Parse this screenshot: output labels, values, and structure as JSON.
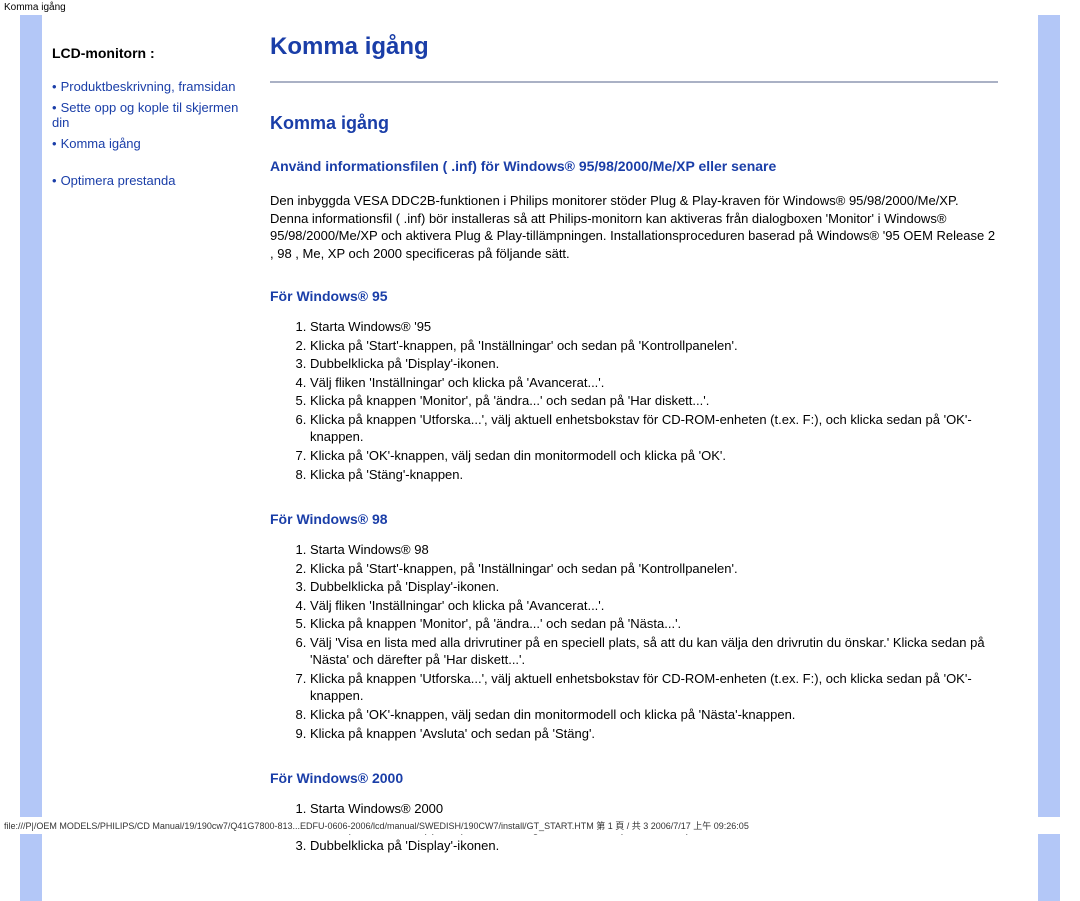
{
  "headerText": "Komma igång",
  "sidebar": {
    "heading": "LCD-monitorn :",
    "items": [
      {
        "label": "Produktbeskrivning, framsidan"
      },
      {
        "label": "Sette opp og kople til skjermen din"
      },
      {
        "label": "Komma igång"
      },
      {
        "label": "Optimera prestanda",
        "spacerBefore": true
      }
    ]
  },
  "main": {
    "h1": "Komma igång",
    "h2": "Komma igång",
    "subhead": "Använd informationsfilen ( .inf) för Windows® 95/98/2000/Me/XP eller senare",
    "paragraph": "Den inbyggda VESA DDC2B-funktionen i Philips monitorer stöder Plug & Play-kraven för Windows® 95/98/2000/Me/XP. Denna informationsfil ( .inf) bör installeras så att Philips-monitorn kan aktiveras från dialogboxen 'Monitor' i Windows® 95/98/2000/Me/XP och aktivera Plug & Play-tillämpningen. Installationsproceduren baserad på Windows® '95 OEM Release 2 , 98 , Me, XP och 2000 specificeras på följande sätt.",
    "sections": [
      {
        "label": "För Windows® 95",
        "steps": [
          "Starta Windows® '95",
          "Klicka på 'Start'-knappen, på 'Inställningar' och sedan på 'Kontrollpanelen'.",
          "Dubbelklicka på 'Display'-ikonen.",
          "Välj fliken 'Inställningar' och klicka på 'Avancerat...'.",
          "Klicka på knappen 'Monitor', på 'ändra...' och sedan på 'Har diskett...'.",
          "Klicka på knappen 'Utforska...', välj aktuell enhetsbokstav för CD-ROM-enheten (t.ex. F:), och klicka sedan på 'OK'-knappen.",
          "Klicka på 'OK'-knappen, välj sedan din monitormodell och klicka på 'OK'.",
          "Klicka på 'Stäng'-knappen."
        ]
      },
      {
        "label": "För Windows® 98",
        "steps": [
          "Starta Windows® 98",
          "Klicka på 'Start'-knappen, på 'Inställningar' och sedan på 'Kontrollpanelen'.",
          "Dubbelklicka på 'Display'-ikonen.",
          "Välj fliken 'Inställningar' och klicka på 'Avancerat...'.",
          "Klicka på knappen 'Monitor', på 'ändra...' och sedan på 'Nästa...'.",
          "Välj 'Visa en lista med alla drivrutiner på en speciell plats, så att du kan välja den drivrutin du önskar.' Klicka sedan på 'Nästa' och därefter på 'Har diskett...'.",
          "Klicka på knappen 'Utforska...', välj aktuell enhetsbokstav för CD-ROM-enheten (t.ex. F:), och klicka sedan på 'OK'-knappen.",
          "Klicka på 'OK'-knappen, välj sedan din monitormodell och klicka på 'Nästa'-knappen.",
          "Klicka på knappen 'Avsluta' och sedan på 'Stäng'."
        ]
      },
      {
        "label": "För Windows® 2000",
        "steps": [
          "Starta Windows® 2000",
          "Klicka på 'Start'-knappen, på 'Inställningar' och sedan på 'Kontrollpanelen'.",
          "Dubbelklicka på 'Display'-ikonen."
        ]
      }
    ]
  },
  "footerPath": "file:///P|/OEM MODELS/PHILIPS/CD Manual/19/190cw7/Q41G7800-813...EDFU-0606-2006/lcd/manual/SWEDISH/190CW7/install/GT_START.HTM 第 1 頁 / 共 3 2006/7/17 上午 09:26:05"
}
